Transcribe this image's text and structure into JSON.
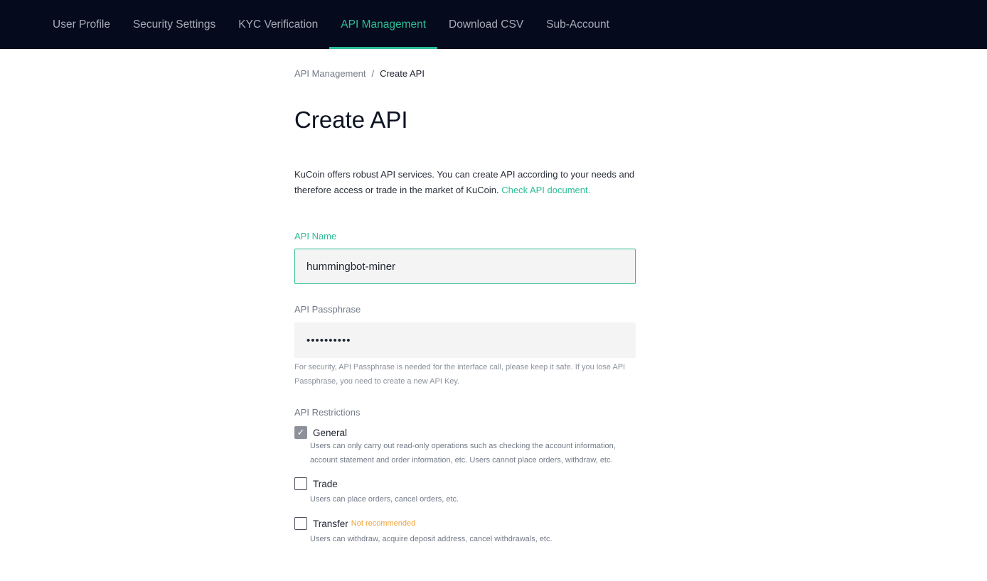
{
  "nav": {
    "tabs": [
      {
        "label": "User Profile"
      },
      {
        "label": "Security Settings"
      },
      {
        "label": "KYC Verification"
      },
      {
        "label": "API Management",
        "active": true
      },
      {
        "label": "Download CSV"
      },
      {
        "label": "Sub-Account"
      }
    ]
  },
  "breadcrumb": {
    "parent": "API Management",
    "separator": "/",
    "current": "Create API"
  },
  "page_title": "Create API",
  "intro": {
    "text": "KuCoin offers robust API services. You can create API according to your needs and therefore access or trade in the market of KuCoin.",
    "link": "Check API document."
  },
  "form": {
    "api_name": {
      "label": "API Name",
      "value": "hummingbot-miner"
    },
    "api_passphrase": {
      "label": "API Passphrase",
      "value": "••••••••••",
      "hint": "For security, API Passphrase is needed for the interface call, please keep it safe. If you lose API Passphrase, you need to create a new API Key."
    },
    "restrictions": {
      "label": "API Restrictions",
      "options": [
        {
          "label": "General",
          "checked": true,
          "description": "Users can only carry out read-only operations such as checking the account information, account statement and order information, etc. Users cannot place orders, withdraw, etc."
        },
        {
          "label": "Trade",
          "checked": false,
          "description": "Users can place orders, cancel orders, etc."
        },
        {
          "label": "Transfer",
          "checked": false,
          "badge": "Not recommended",
          "description": "Users can withdraw, acquire deposit address, cancel withdrawals, etc."
        }
      ]
    }
  },
  "colors": {
    "accent": "#2dbd96",
    "nav_bg": "#050b1d",
    "warning": "#f0a33a"
  }
}
